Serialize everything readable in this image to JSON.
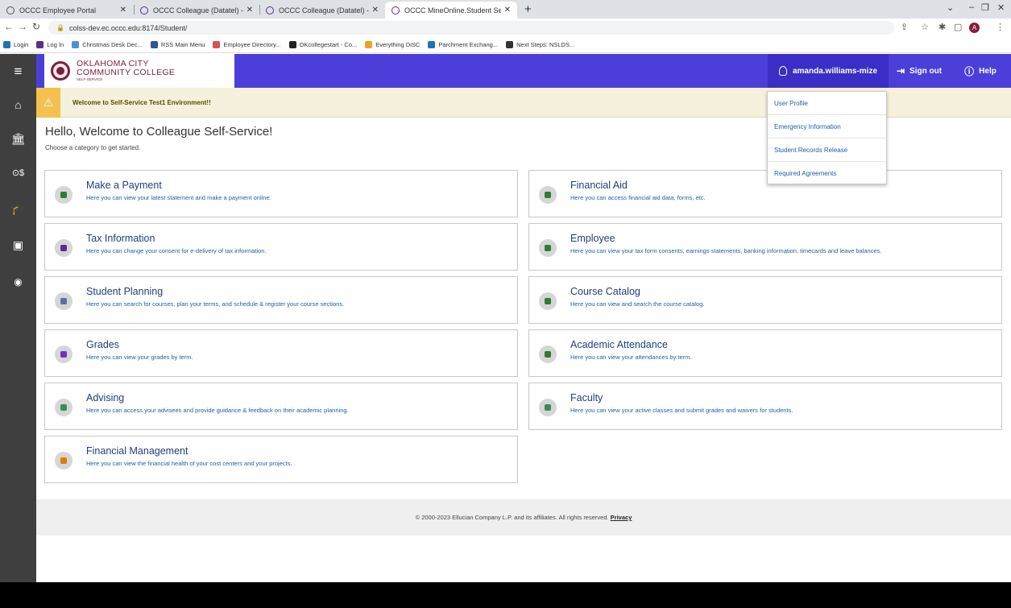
{
  "browser": {
    "tabs": [
      {
        "title": "OCCC Employee Portal",
        "active": false
      },
      {
        "title": "OCCC Colleague (Datatel) - [proc",
        "active": false
      },
      {
        "title": "OCCC Colleague (Datatel) - [test",
        "active": false
      },
      {
        "title": "OCCC MineOnline.Student Self-S",
        "active": true
      }
    ],
    "new_tab": "+",
    "url": "colss-dev.ec.occc.edu:8174/Student/",
    "profile_initial": "A",
    "bookmarks": [
      {
        "label": "Login",
        "color": "#1e73be"
      },
      {
        "label": "Log In",
        "color": "#5b2d8f"
      },
      {
        "label": "Christmas Desk Dec...",
        "color": "#4a90d9"
      },
      {
        "label": "RSS Main Menu",
        "color": "#2b5797"
      },
      {
        "label": "Employee Directory...",
        "color": "#d9534f"
      },
      {
        "label": "OKcollegestart - Co...",
        "color": "#222222"
      },
      {
        "label": "Everything DiSC",
        "color": "#f0a020"
      },
      {
        "label": "Parchment Exchang...",
        "color": "#1e73be"
      },
      {
        "label": "Next Steps: NSLDS...",
        "color": "#333333"
      }
    ]
  },
  "header": {
    "logo_line1": "OKLAHOMA CITY",
    "logo_line2": "COMMUNITY COLLEGE",
    "logo_line3": "SELF-SERVICE",
    "user": "amanda.williams-mize",
    "sign_out": "Sign out",
    "help": "Help",
    "color": "#4c3fd9"
  },
  "banner": {
    "text": "Welcome to Self-Service Test1 Environment!!"
  },
  "page": {
    "greeting": "Hello, Welcome to Colleague Self-Service!",
    "subtitle": "Choose a category to get started."
  },
  "cards": [
    {
      "title": "Make a Payment",
      "desc": "Here you can view your latest statement and make a payment online.",
      "icon": "payment-icon",
      "color": "#2e7d32"
    },
    {
      "title": "Financial Aid",
      "desc": "Here you can access financial aid data, forms, etc.",
      "icon": "financial-aid-icon",
      "color": "#2e7d32"
    },
    {
      "title": "Tax Information",
      "desc": "Here you can change your consent for e-delivery of tax information.",
      "icon": "tax-icon",
      "color": "#5b2d8f"
    },
    {
      "title": "Employee",
      "desc": "Here you can view your tax form consents, earnings statements, banking information, timecards and leave balances.",
      "icon": "employee-icon",
      "color": "#2e7d32"
    },
    {
      "title": "Student Planning",
      "desc": "Here you can search for courses, plan your terms, and schedule & register your course sections.",
      "icon": "calendar-icon",
      "color": "#5b6ea8"
    },
    {
      "title": "Course Catalog",
      "desc": "Here you can view and search the course catalog.",
      "icon": "catalog-icon",
      "color": "#2e7d32"
    },
    {
      "title": "Grades",
      "desc": "Here you can view your grades by term.",
      "icon": "grades-icon",
      "color": "#7b2cbf"
    },
    {
      "title": "Academic Attendance",
      "desc": "Here you can view your attendances by term.",
      "icon": "attendance-icon",
      "color": "#2e7d32"
    },
    {
      "title": "Advising",
      "desc": "Here you can access your advisees and provide guidance & feedback on their academic planning.",
      "icon": "advising-icon",
      "color": "#3a8a5c"
    },
    {
      "title": "Faculty",
      "desc": "Here you can view your active classes and submit grades and waivers for students.",
      "icon": "faculty-icon",
      "color": "#3a8a5c"
    },
    {
      "title": "Financial Management",
      "desc": "Here you can view the financial health of your cost centers and your projects.",
      "icon": "pie-chart-icon",
      "color": "#e07b00"
    }
  ],
  "dropdown": {
    "items": [
      "User Profile",
      "Emergency Information",
      "Student Records Release",
      "Required Agreements"
    ]
  },
  "footer": {
    "text": "© 2000-2023 Ellucian Company L.P. and its affiliates. All rights reserved.",
    "privacy": "Privacy"
  }
}
